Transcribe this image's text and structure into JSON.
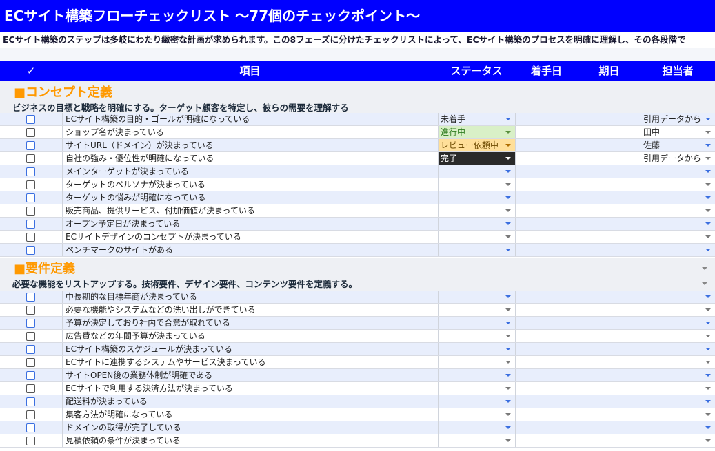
{
  "title": "ECサイト構築フローチェックリスト 〜77個のチェックポイント〜",
  "description": "ECサイト構築のステップは多岐にわたり緻密な計画が求められます。この8フェーズに分けたチェックリストによって、ECサイト構築のプロセスを明確に理解し、その各段階で",
  "headers": {
    "check": "✓",
    "item": "項目",
    "status": "ステータス",
    "start": "着手日",
    "due": "期日",
    "owner": "担当者"
  },
  "sections": [
    {
      "title": "■コンセプト定義",
      "desc": "ビジネスの目標と戦略を明確にする。ターゲット顧客を特定し、彼らの需要を理解する",
      "rows": [
        {
          "item": "ECサイト構築の目的・ゴールが明確になっている",
          "status": "未着手",
          "owner": "引用データから"
        },
        {
          "item": "ショップ名が決まっている",
          "status": "進行中",
          "owner": "田中"
        },
        {
          "item": "サイトURL（ドメイン）が決まっている",
          "status": "レビュー依頼中",
          "owner": "佐藤"
        },
        {
          "item": "自社の強み・優位性が明確になっている",
          "status": "完了",
          "owner": "引用データから"
        },
        {
          "item": "メインターゲットが決まっている",
          "status": "",
          "owner": ""
        },
        {
          "item": "ターゲットのペルソナが決まっている",
          "status": "",
          "owner": ""
        },
        {
          "item": "ターゲットの悩みが明確になっている",
          "status": "",
          "owner": ""
        },
        {
          "item": "販売商品、提供サービス、付加価値が決まっている",
          "status": "",
          "owner": ""
        },
        {
          "item": "オープン予定日が決まっている",
          "status": "",
          "owner": ""
        },
        {
          "item": "ECサイトデザインのコンセプトが決まっている",
          "status": "",
          "owner": ""
        },
        {
          "item": "ベンチマークのサイトがある",
          "status": "",
          "owner": ""
        }
      ]
    },
    {
      "title": "■要件定義",
      "desc": "必要な機能をリストアップする。技術要件、デザイン要件、コンテンツ要件を定義する。",
      "rows": [
        {
          "item": "中長期的な目標年商が決まっている",
          "status": "",
          "owner": ""
        },
        {
          "item": "必要な機能やシステムなどの洗い出しができている",
          "status": "",
          "owner": ""
        },
        {
          "item": "予算が決定しており社内で合意が取れている",
          "status": "",
          "owner": ""
        },
        {
          "item": "広告費などの年間予算が決まっている",
          "status": "",
          "owner": ""
        },
        {
          "item": "ECサイト構築のスケジュールが決まっている",
          "status": "",
          "owner": ""
        },
        {
          "item": "ECサイトに連携するシステムやサービス決まっている",
          "status": "",
          "owner": ""
        },
        {
          "item": "サイトOPEN後の業務体制が明確である",
          "status": "",
          "owner": ""
        },
        {
          "item": "ECサイトで利用する決済方法が決まっている",
          "status": "",
          "owner": ""
        },
        {
          "item": "配送料が決まっている",
          "status": "",
          "owner": ""
        },
        {
          "item": "集客方法が明確になっている",
          "status": "",
          "owner": ""
        },
        {
          "item": "ドメインの取得が完了している",
          "status": "",
          "owner": ""
        },
        {
          "item": "見積依頼の条件が決まっている",
          "status": "",
          "owner": ""
        }
      ]
    }
  ]
}
